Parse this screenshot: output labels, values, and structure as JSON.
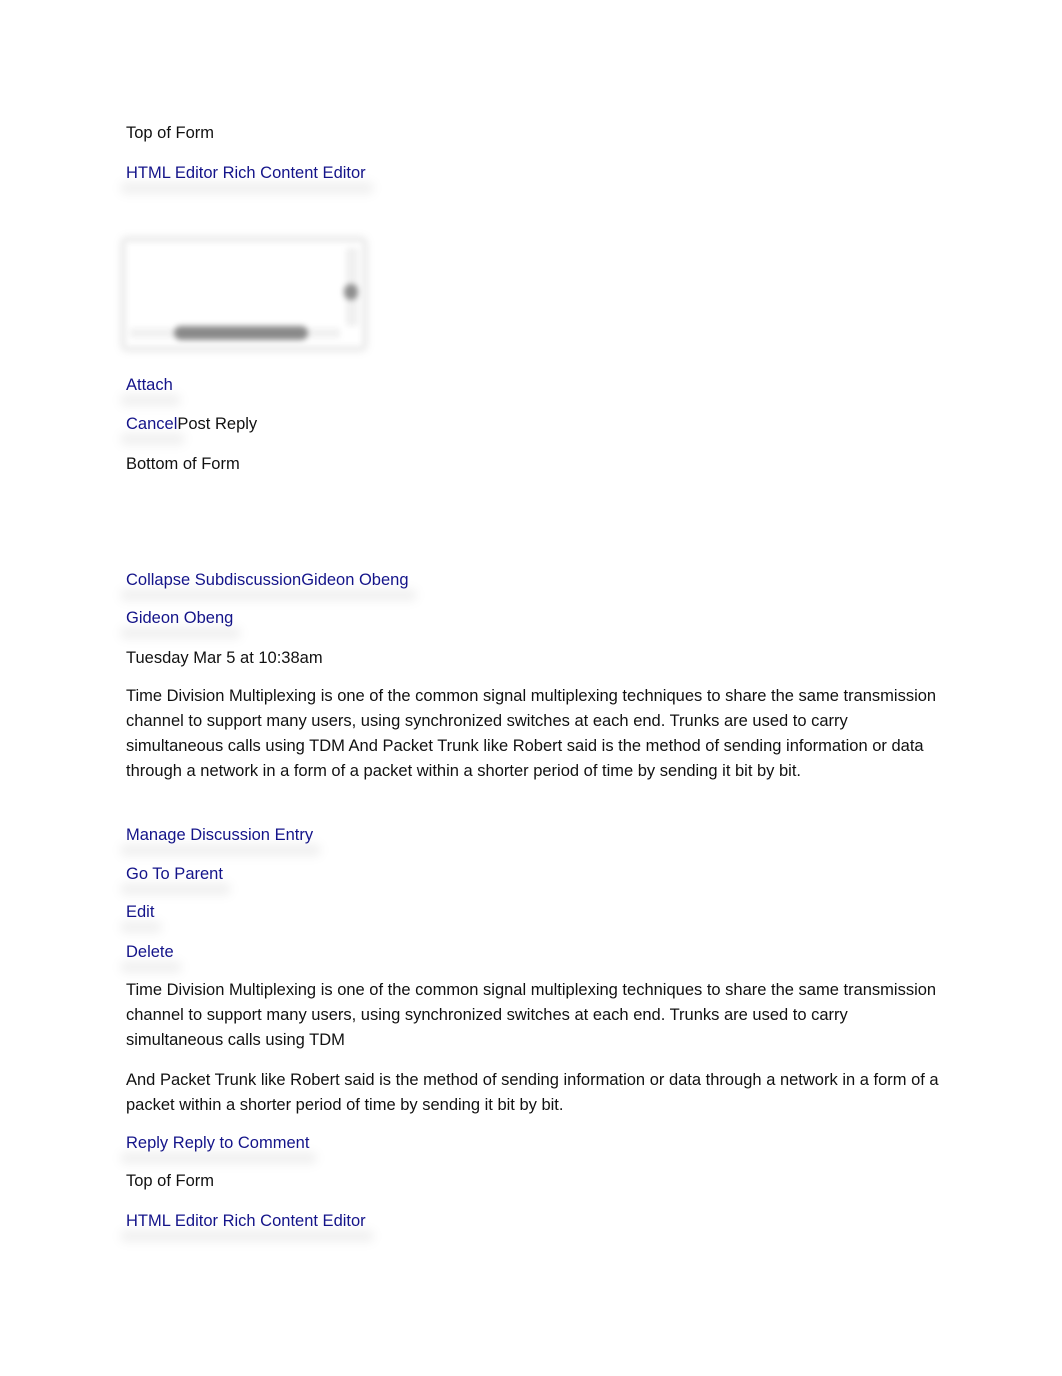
{
  "colors": {
    "link": "#14148a",
    "text": "#111111",
    "background": "#ffffff"
  },
  "form_top": {
    "top_of_form": "Top of Form",
    "html_editor_link": "HTML Editor",
    "rich_content_editor_link": "Rich Content Editor",
    "attach_link": "Attach",
    "cancel_link": "Cancel",
    "post_reply_label": "Post Reply",
    "bottom_of_form": "Bottom of Form"
  },
  "entry": {
    "collapse_link": "Collapse Subdiscussion",
    "author_inline": "Gideon Obeng",
    "author": "Gideon Obeng",
    "timestamp": "Tuesday Mar 5 at 10:38am",
    "summary_text": "Time Division Multiplexing is one of the common signal multiplexing techniques to share the same transmission channel to support many users, using synchronized switches at each end. Trunks are used to carry simultaneous calls using TDM And Packet Trunk like Robert said is the method of sending information or data through a network in a form of a packet within a shorter period of time by sending it bit by bit.",
    "actions": {
      "manage": "Manage Discussion Entry",
      "go_to_parent": "Go To Parent",
      "edit": "Edit",
      "delete": "Delete"
    },
    "body_paragraph_1": "Time Division Multiplexing is one of the common signal multiplexing techniques to share the same transmission channel to support many users, using synchronized switches at each end. Trunks are used to carry simultaneous calls using TDM",
    "body_paragraph_2": "And Packet Trunk like Robert said is the method of sending information or data through a network in a form of a packet within a shorter period of time by sending it bit by bit.",
    "reply_link": "Reply",
    "reply_to_comment_link": "Reply to Comment"
  },
  "form_bottom": {
    "top_of_form": "Top of Form",
    "html_editor_link": "HTML Editor",
    "rich_content_editor_link": "Rich Content Editor"
  }
}
